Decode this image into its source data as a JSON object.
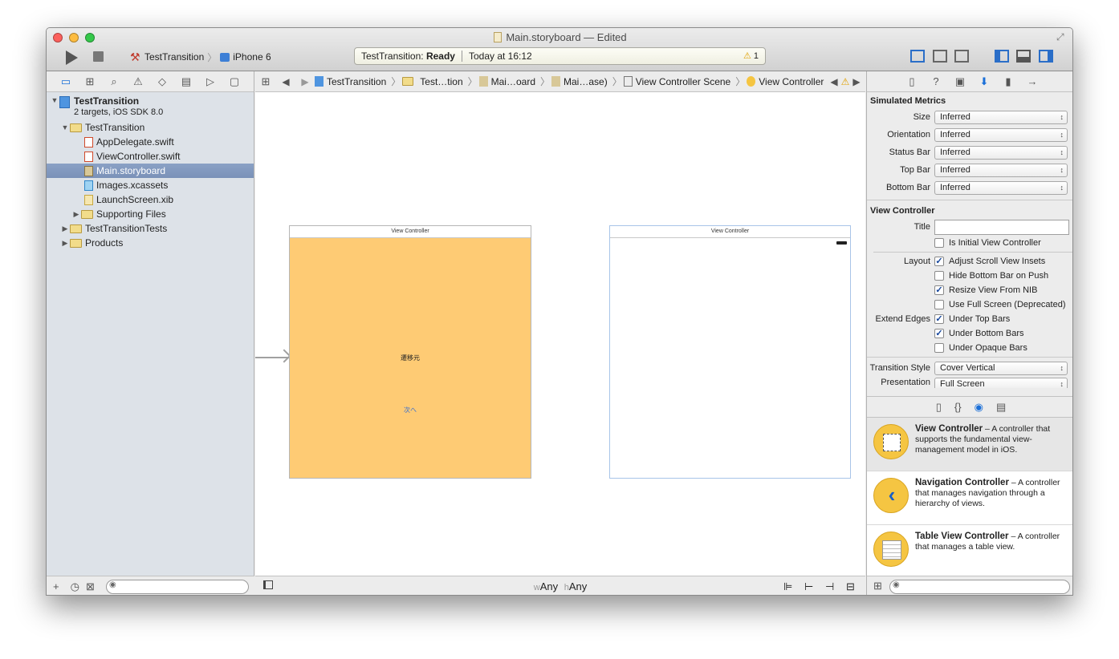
{
  "window": {
    "title": "Main.storyboard — Edited"
  },
  "toolbar": {
    "scheme": "TestTransition",
    "device": "iPhone 6",
    "activity_app": "TestTransition:",
    "activity_status": "Ready",
    "activity_time": "Today at 16:12",
    "warning_count": "1"
  },
  "navigator": {
    "project_name": "TestTransition",
    "project_sub": "2 targets, iOS SDK 8.0",
    "items": [
      {
        "label": "TestTransition"
      },
      {
        "label": "AppDelegate.swift"
      },
      {
        "label": "ViewController.swift"
      },
      {
        "label": "Main.storyboard"
      },
      {
        "label": "Images.xcassets"
      },
      {
        "label": "LaunchScreen.xib"
      },
      {
        "label": "Supporting Files"
      },
      {
        "label": "TestTransitionTests"
      },
      {
        "label": "Products"
      }
    ]
  },
  "jumpbar": [
    "TestTransition",
    "Test…tion",
    "Mai…oard",
    "Mai…ase)",
    "View Controller Scene",
    "View Controller"
  ],
  "canvas": {
    "vc1_title": "View Controller",
    "vc1_label": "遷移元",
    "vc1_button": "次へ",
    "vc2_title": "View Controller",
    "size_w_key": "w",
    "size_w_val": "Any",
    "size_h_key": "h",
    "size_h_val": "Any"
  },
  "inspector": {
    "simulated_title": "Simulated Metrics",
    "metrics": [
      {
        "label": "Size",
        "value": "Inferred"
      },
      {
        "label": "Orientation",
        "value": "Inferred"
      },
      {
        "label": "Status Bar",
        "value": "Inferred"
      },
      {
        "label": "Top Bar",
        "value": "Inferred"
      },
      {
        "label": "Bottom Bar",
        "value": "Inferred"
      }
    ],
    "vc_title": "View Controller",
    "title_label": "Title",
    "initial_label": "Is Initial View Controller",
    "layout_label": "Layout",
    "layout_opts": [
      "Adjust Scroll View Insets",
      "Hide Bottom Bar on Push",
      "Resize View From NIB",
      "Use Full Screen (Deprecated)"
    ],
    "extend_label": "Extend Edges",
    "extend_opts": [
      "Under Top Bars",
      "Under Bottom Bars",
      "Under Opaque Bars"
    ],
    "transition_label": "Transition Style",
    "transition_value": "Cover Vertical",
    "presentation_label": "Presentation",
    "presentation_value": "Full Screen"
  },
  "library": {
    "items": [
      {
        "name": "View Controller",
        "desc": " – A controller that supports the fundamental view-management model in iOS."
      },
      {
        "name": "Navigation Controller",
        "desc": " – A controller that manages navigation through a hierarchy of views."
      },
      {
        "name": "Table View Controller",
        "desc": " – A controller that manages a table view."
      }
    ]
  },
  "colors": {
    "vc_background": "#fecb74",
    "accent": "#1a6fd8",
    "selection": "#7f96bd"
  }
}
